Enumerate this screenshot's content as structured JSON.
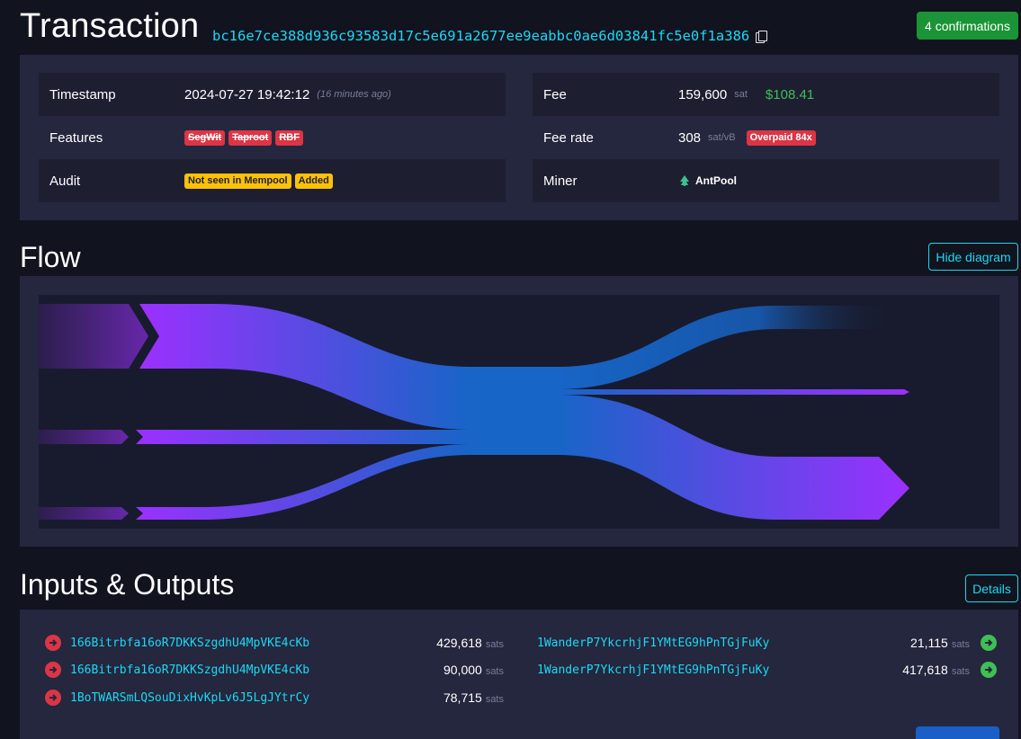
{
  "header": {
    "title": "Transaction",
    "txid": "bc16e7ce388d936c93583d17c5e691a2677ee9eabbc0ae6d03841fc5e0f1a386",
    "confirmations": "4 confirmations",
    "icons": {
      "copy": "copy-icon"
    }
  },
  "details": {
    "timestamp": {
      "label": "Timestamp",
      "value": "2024-07-27 19:42:12",
      "ago": "(16 minutes ago)"
    },
    "features": {
      "label": "Features",
      "tags": [
        "SegWit",
        "Taproot",
        "RBF"
      ]
    },
    "audit": {
      "label": "Audit",
      "tags": [
        "Not seen in Mempool",
        "Added"
      ]
    },
    "fee": {
      "label": "Fee",
      "value": "159,600",
      "unit": "sat",
      "usd": "$108.41"
    },
    "fee_rate": {
      "label": "Fee rate",
      "value": "308",
      "unit": "sat/vB",
      "badge": "Overpaid 84x"
    },
    "miner": {
      "label": "Miner",
      "name": "AntPool",
      "icon": "antpool-logo-icon"
    }
  },
  "flow": {
    "title": "Flow",
    "hide_button": "Hide diagram"
  },
  "io": {
    "title": "Inputs & Outputs",
    "details_button": "Details",
    "inputs": [
      {
        "address": "166Bitrbfa16oR7DKKSzgdhU4MpVKE4cKb",
        "amount": "429,618",
        "unit": "sats"
      },
      {
        "address": "166Bitrbfa16oR7DKKSzgdhU4MpVKE4cKb",
        "amount": "90,000",
        "unit": "sats"
      },
      {
        "address": "1BoTWARSmLQSouDixHvKpLv6J5LgJYtrCy",
        "amount": "78,715",
        "unit": "sats"
      }
    ],
    "outputs": [
      {
        "address": "1WanderP7YkcrhjF1YMtEG9hPnTGjFuKy",
        "amount": "21,115",
        "unit": "sats"
      },
      {
        "address": "1WanderP7YkcrhjF1YMtEG9hPnTGjFuKy",
        "amount": "417,618",
        "unit": "sats"
      }
    ]
  },
  "colors": {
    "accent": "#1bd8f4",
    "success": "#1a9436",
    "danger": "#dc3545",
    "warning": "#ffc107",
    "flow_purple": "#9b30ff",
    "flow_blue": "#1765c7"
  }
}
